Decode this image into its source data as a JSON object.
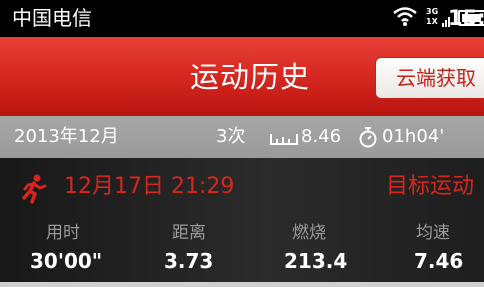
{
  "status_bar": {
    "carrier": "中国电信",
    "net_top": "3G",
    "net_bottom": "1X",
    "time": "15:3"
  },
  "header": {
    "title": "运动历史",
    "cloud_button": "云端获取"
  },
  "summary": {
    "month": "2013年12月",
    "count": "3次",
    "distance": "8.46",
    "duration": "01h04'"
  },
  "record": {
    "datetime": "12月17日 21:29",
    "type": "目标运动",
    "stats": [
      {
        "label": "用时",
        "value": "30'00\""
      },
      {
        "label": "距离",
        "value": "3.73"
      },
      {
        "label": "燃烧",
        "value": "213.4"
      },
      {
        "label": "均速",
        "value": "7.46"
      }
    ]
  },
  "colors": {
    "title_bar": "#d82a22",
    "accent_red": "#d8261e",
    "summary_bg": "#a3a3a3"
  },
  "icons": [
    "wifi-icon",
    "signal-icon",
    "battery-icon",
    "alarm-icon",
    "ruler-icon",
    "stopwatch-icon",
    "running-man-icon"
  ]
}
